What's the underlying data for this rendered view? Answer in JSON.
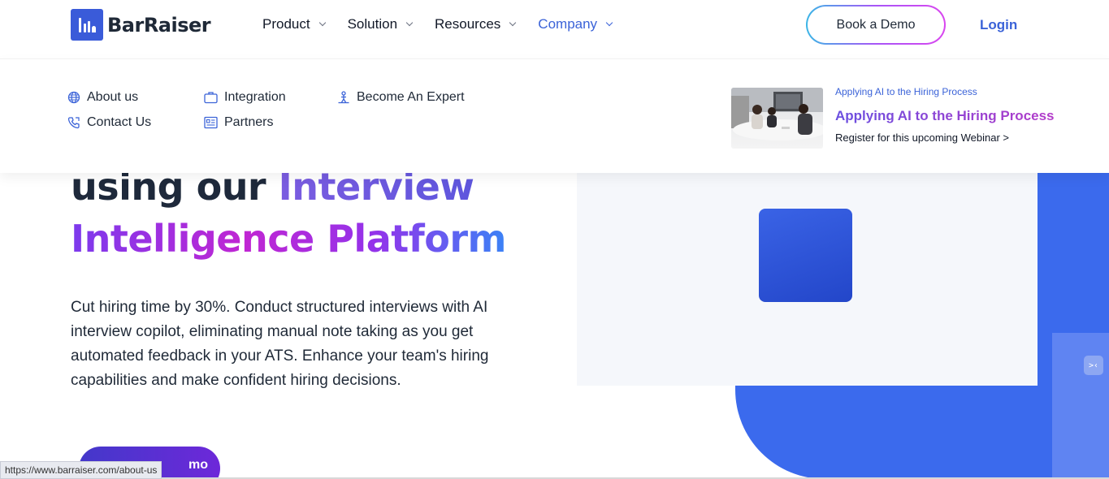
{
  "header": {
    "brand": "BarRaiser",
    "nav": [
      {
        "label": "Product"
      },
      {
        "label": "Solution"
      },
      {
        "label": "Resources"
      },
      {
        "label": "Company"
      }
    ],
    "book_demo": "Book a Demo",
    "login": "Login"
  },
  "dropdown": {
    "col1": [
      {
        "label": "About us",
        "icon": "globe-icon"
      },
      {
        "label": "Contact Us",
        "icon": "phone-icon"
      }
    ],
    "col2": [
      {
        "label": "Integration",
        "icon": "briefcase-icon"
      },
      {
        "label": "Partners",
        "icon": "id-card-icon"
      }
    ],
    "col3": [
      {
        "label": "Become An Expert",
        "icon": "expert-icon"
      }
    ],
    "promo": {
      "eyebrow": "Applying AI to the Hiring Process",
      "title": "Applying AI to the Hiring Process",
      "link": "Register for this upcoming Webinar >"
    }
  },
  "hero": {
    "line1_plain": "using our ",
    "line1_accent": "Interview",
    "line2_accent": "Intelligence Platform",
    "description": "Cut hiring time by 30%. Conduct structured interviews with AI interview copilot, eliminating manual note taking as you get automated feedback in your ATS. Enhance your team's hiring capabilities and make confident hiring decisions.",
    "cta": "Book a Demo",
    "cta_visible": "mo"
  },
  "status_bar": {
    "url": "https://www.barraiser.com/about-us"
  },
  "colors": {
    "brand_blue": "#3b63d8",
    "hero_blue": "#3b6aed",
    "purple": "#7c3aed",
    "magenta": "#c026d3"
  }
}
